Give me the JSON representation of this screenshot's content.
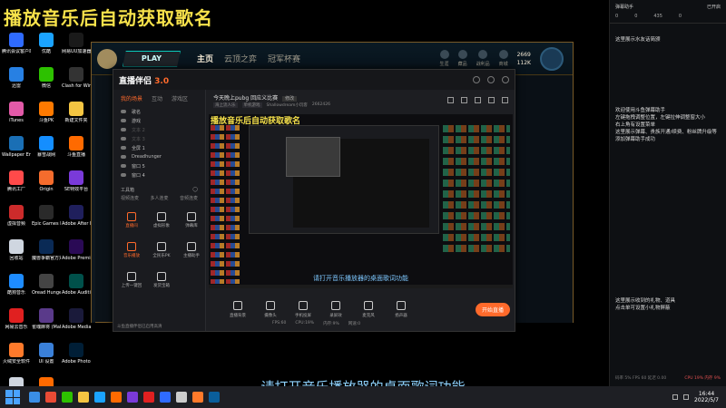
{
  "desktop": {
    "title": "播放音乐后自动获取歌名",
    "icons": [
      {
        "label": "腾讯会议客户端",
        "color": "#2f6bff"
      },
      {
        "label": "优酷",
        "color": "#1ba3ff"
      },
      {
        "label": "网易UU加速器",
        "color": "#1a1a1a"
      },
      {
        "label": "迅雷",
        "color": "#2780e3"
      },
      {
        "label": "微信",
        "color": "#2dc100"
      },
      {
        "label": "Clash for Windows...",
        "color": "#333333"
      },
      {
        "label": "iTunes",
        "color": "#e25aa8"
      },
      {
        "label": "斗鱼PK",
        "color": "#ff7a00"
      },
      {
        "label": "新建文件夹",
        "color": "#f4c542"
      },
      {
        "label": "Wallpaper Engine:...",
        "color": "#1a6fb5"
      },
      {
        "label": "暴雪战网",
        "color": "#148eff"
      },
      {
        "label": "斗鱼直播",
        "color": "#ff6a00"
      },
      {
        "label": "腾讯工厂",
        "color": "#ff4a4a"
      },
      {
        "label": "Origin",
        "color": "#f56c2d"
      },
      {
        "label": "SE特效平台",
        "color": "#7a3ad9"
      },
      {
        "label": "虚拟音频",
        "color": "#cc2b2b"
      },
      {
        "label": "Epic Games Launcher",
        "color": "#2a2a2a"
      },
      {
        "label": "Adobe After Effects 2022",
        "color": "#1f1f5c"
      },
      {
        "label": "回收站",
        "color": "#cfd6e0"
      },
      {
        "label": "魔兽争霸官方对战平台",
        "color": "#0a2a55"
      },
      {
        "label": "Adobe Premie...",
        "color": "#2a0a55"
      },
      {
        "label": "酷狗音乐",
        "color": "#1e8cff"
      },
      {
        "label": "Oread Hunger",
        "color": "#444444"
      },
      {
        "label": "Adobe Auditi...",
        "color": "#00504a"
      },
      {
        "label": "网易云音乐",
        "color": "#e02020"
      },
      {
        "label": "雀魂麻将 (Mahjong...",
        "color": "#5a3a8a"
      },
      {
        "label": "Adobe Media...",
        "color": "#1a1a3a"
      },
      {
        "label": "火绒安全软件",
        "color": "#ff7a2b"
      },
      {
        "label": "UI 设置",
        "color": "#3a80d9"
      },
      {
        "label": "Adobe Photosho...",
        "color": "#001e36"
      },
      {
        "label": "回收站",
        "color": "#cfd6e0"
      },
      {
        "label": "斗鱼直播伴侣",
        "color": "#ff6a00"
      }
    ]
  },
  "lol": {
    "play_label": "PLAY",
    "nav": [
      "主页",
      "云顶之弈",
      "冠军杯赛"
    ],
    "right_items": [
      "生涯",
      "藏品",
      "战利品",
      "商城"
    ],
    "be": "2669",
    "rp": "112K"
  },
  "obs": {
    "app_name": "直播伴侣",
    "app_badge": "3.0",
    "tabs": [
      "我的场景",
      "互动",
      "游戏区"
    ],
    "sources": [
      {
        "label": "歌名",
        "dim": false
      },
      {
        "label": "游戏",
        "dim": false
      },
      {
        "label": "文本 2",
        "dim": true
      },
      {
        "label": "文本 3",
        "dim": true
      },
      {
        "label": "全屏 1",
        "dim": false
      },
      {
        "label": "Dreadhunger",
        "dim": false
      },
      {
        "label": "窗口 5",
        "dim": false
      },
      {
        "label": "窗口 4",
        "dim": false
      }
    ],
    "tools_title": "工具箱",
    "tools_row": [
      "视频连麦",
      "多人连麦",
      "音频连麦"
    ],
    "tools": [
      {
        "label": "直播间",
        "style": "red"
      },
      {
        "label": "虚拟形象",
        "style": "white"
      },
      {
        "label": "弹幕库",
        "style": "white"
      },
      {
        "label": "音乐播放",
        "style": "red"
      },
      {
        "label": "全民乐PK",
        "style": "white"
      },
      {
        "label": "主播助手",
        "style": "white"
      },
      {
        "label": "上传一键回",
        "style": "white"
      },
      {
        "label": "发货宝箱",
        "style": "white"
      }
    ],
    "footer": "斗鱼直播伴侣已启用高清",
    "stream_title": "今天晚上pubg 回应义比赛",
    "stream_badge": "修改",
    "meta": [
      "海上流人乐",
      "单机游戏",
      "Shallowdream小玩客",
      "2662426"
    ],
    "preview_title": "播放音乐后自动获取歌名",
    "preview_caption": "请打开音乐播放器的桌面歌词功能",
    "bottom_buttons": [
      "直播背景",
      "摄像头",
      "手机投屏",
      "录屏效",
      "麦克风",
      "扬声器"
    ],
    "live_button": "开始直播",
    "stats": [
      "FPS:60",
      "CPU:19%",
      "内存:9%",
      "网速:0"
    ]
  },
  "danmu": {
    "header_left": "弹幕助手",
    "header_right": "已开启",
    "stats": [
      "0",
      "0",
      "435",
      "0"
    ],
    "lines": [
      {
        "text": "欢迎使用斗鱼弹幕助手",
        "dim": false
      },
      {
        "text": "左键拖拽调整位置，左键拉伸调整窗大小",
        "dim": false
      },
      {
        "text": "右上角有设置菜单",
        "dim": false
      },
      {
        "text": "这里展示弹幕、贵族开通/续费、粉丝牌升级等",
        "dim": false
      },
      {
        "text": "添加弹幕助手成功",
        "dim": false
      }
    ],
    "top_line": "这里展示水友话简颁",
    "lines2": [
      {
        "text": "这里展示收到的礼物、道具",
        "dim": false
      },
      {
        "text": "点击单可设置小礼物屏蔽",
        "dim": false
      }
    ],
    "bottom_left": "码率 5% FPS 60 延迟 0.00",
    "bottom_right": "CPU 19% 内存 9%"
  },
  "caption": "请打开音乐播放器的桌面歌词功能",
  "taskbar": {
    "apps": [
      "#3a8ee6",
      "#e94b35",
      "#2dc100",
      "#f4c542",
      "#1ba3ff",
      "#ff6a00",
      "#7a3ad9",
      "#e02020",
      "#2f6bff",
      "#cccccc",
      "#ff7a2b",
      "#0a5e9b"
    ],
    "time": "16:44",
    "date": "2022/5/7"
  }
}
